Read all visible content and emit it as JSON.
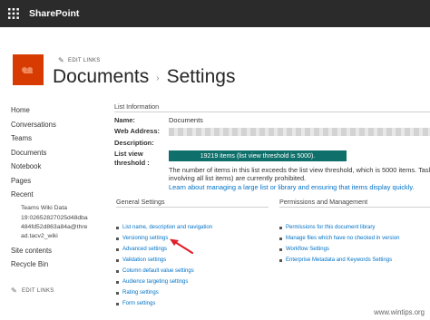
{
  "suitebar": {
    "brand": "SharePoint",
    "waffle_icon": "waffle-app-launcher-icon"
  },
  "site": {
    "logo_icon": "site-logo-icon",
    "edit_links": "EDIT LINKS"
  },
  "title": {
    "part1": "Documents",
    "separator": "›",
    "part2": "Settings"
  },
  "leftnav": {
    "items": [
      {
        "label": "Home"
      },
      {
        "label": "Conversations"
      },
      {
        "label": "Teams"
      },
      {
        "label": "Documents"
      },
      {
        "label": "Notebook"
      },
      {
        "label": "Pages"
      },
      {
        "label": "Recent"
      }
    ],
    "recent_sub1": "Teams Wiki Data",
    "recent_sub2": [
      "19:02652827025d48dba",
      "484fd52d863a84a@thre",
      "ad.tacv2_wiki"
    ],
    "items_after": [
      {
        "label": "Site contents"
      },
      {
        "label": "Recycle Bin"
      }
    ],
    "edit_links": "EDIT LINKS"
  },
  "list_info": {
    "heading": "List Information",
    "name_label": "Name:",
    "name_value": "Documents",
    "web_address_label": "Web Address:",
    "description_label": "Description:",
    "threshold_label": "List view threshold :",
    "threshold_bar": "19219 items (list view threshold is 5000).",
    "warning_line1": "The number of items in this list exceeds the list view threshold, which is 5000 items. Tasl",
    "warning_line2": "involving all list items) are currently prohibited.",
    "learn_more": "Learn about managing a large list or library and ensuring that items display quickly."
  },
  "general_settings": {
    "heading": "General Settings",
    "links": [
      "List name, description and navigation",
      "Versioning settings",
      "Advanced settings",
      "Validation settings",
      "Column default value settings",
      "Audience targeting settings",
      "Rating settings",
      "Form settings"
    ]
  },
  "permissions": {
    "heading": "Permissions and Management",
    "links": [
      "Permissions for this document library",
      "Manage files which have no checked in version",
      "Workflow Settings",
      "Enterprise Metadata and Keywords Settings"
    ]
  },
  "watermark": "www.wintips.org",
  "colors": {
    "suitebar": "#2b2b2b",
    "logo": "#d83b01",
    "link": "#0072c6",
    "threshold": "#0f6f6a",
    "arrow": "#e0202a"
  }
}
